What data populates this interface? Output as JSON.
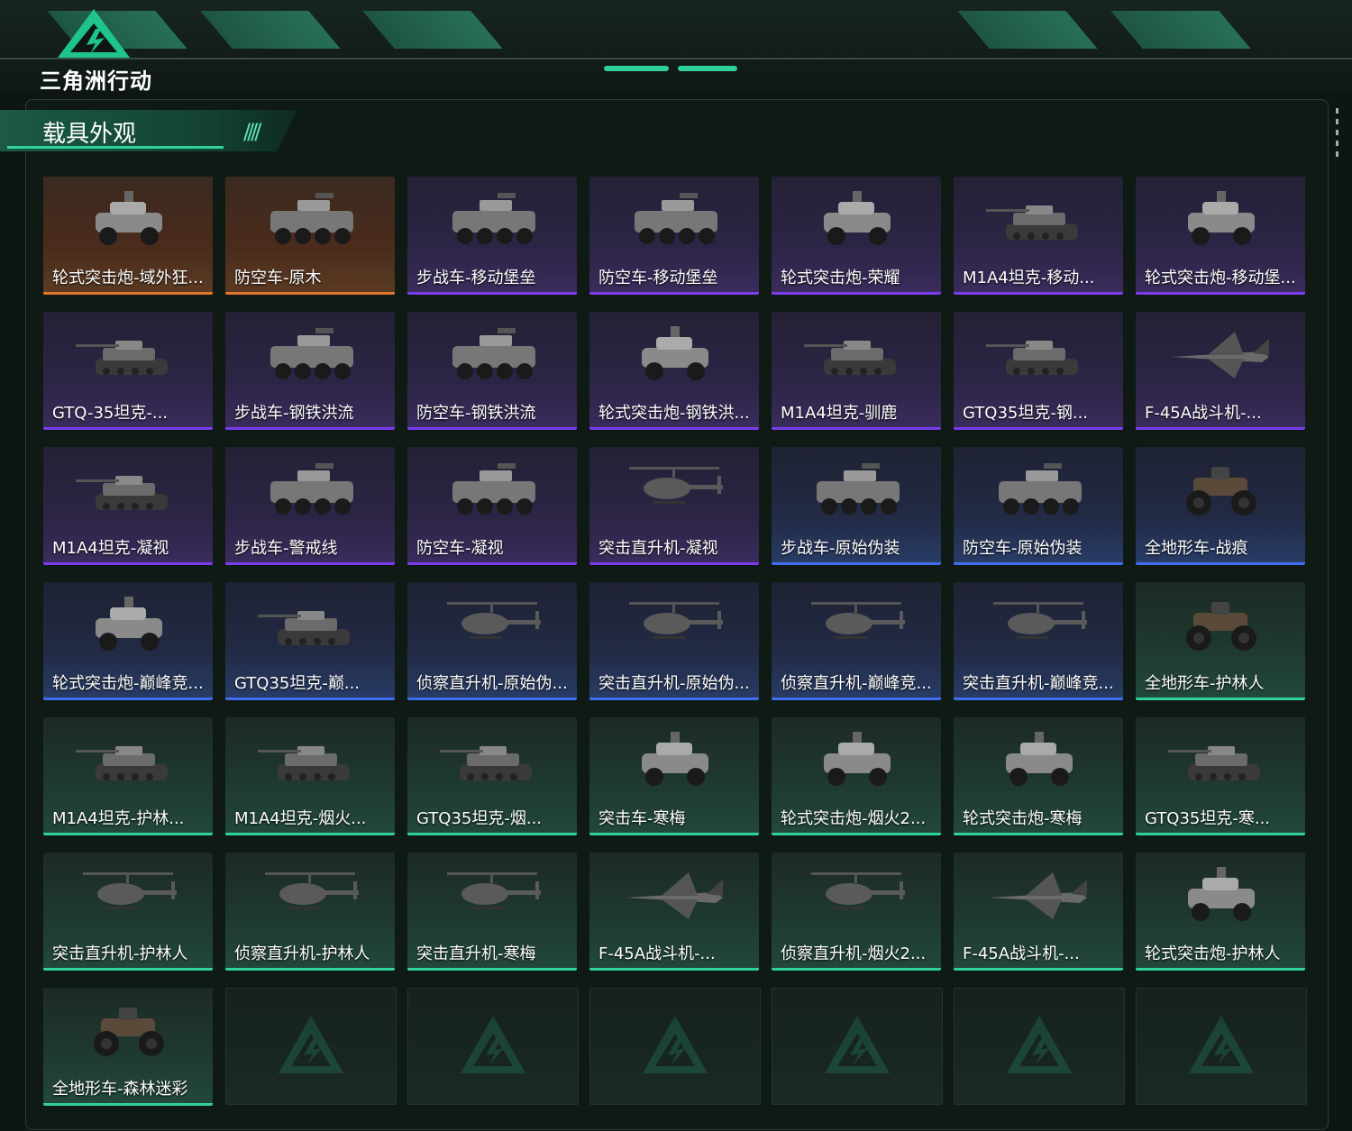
{
  "game": {
    "title": "三角洲行动"
  },
  "section": {
    "title": "载具外观"
  },
  "colors": {
    "orange": "#e0762c",
    "purple": "#7a3df0",
    "blue": "#3f6ef0",
    "green": "#2ed19a"
  },
  "items": [
    {
      "label": "轮式突击炮-域外狂...",
      "rarity": "orange",
      "kind": "apc"
    },
    {
      "label": "防空车-原木",
      "rarity": "orange",
      "kind": "ifv"
    },
    {
      "label": "步战车-移动堡垒",
      "rarity": "purple",
      "kind": "ifv"
    },
    {
      "label": "防空车-移动堡垒",
      "rarity": "purple",
      "kind": "ifv"
    },
    {
      "label": "轮式突击炮-荣耀",
      "rarity": "purple",
      "kind": "apc"
    },
    {
      "label": "M1A4坦克-移动...",
      "rarity": "purple",
      "kind": "tank"
    },
    {
      "label": "轮式突击炮-移动堡...",
      "rarity": "purple",
      "kind": "apc"
    },
    {
      "label": "GTQ-35坦克-...",
      "rarity": "purple",
      "kind": "tank"
    },
    {
      "label": "步战车-钢铁洪流",
      "rarity": "purple",
      "kind": "ifv"
    },
    {
      "label": "防空车-钢铁洪流",
      "rarity": "purple",
      "kind": "ifv"
    },
    {
      "label": "轮式突击炮-钢铁洪...",
      "rarity": "purple",
      "kind": "apc"
    },
    {
      "label": "M1A4坦克-驯鹿",
      "rarity": "purple",
      "kind": "tank"
    },
    {
      "label": "GTQ35坦克-钢...",
      "rarity": "purple",
      "kind": "tank"
    },
    {
      "label": "F-45A战斗机-...",
      "rarity": "purple",
      "kind": "jet"
    },
    {
      "label": "M1A4坦克-凝视",
      "rarity": "purple",
      "kind": "tank"
    },
    {
      "label": "步战车-警戒线",
      "rarity": "purple",
      "kind": "ifv"
    },
    {
      "label": "防空车-凝视",
      "rarity": "purple",
      "kind": "ifv"
    },
    {
      "label": "突击直升机-凝视",
      "rarity": "purple",
      "kind": "heli"
    },
    {
      "label": "步战车-原始伪装",
      "rarity": "blue",
      "kind": "ifv"
    },
    {
      "label": "防空车-原始伪装",
      "rarity": "blue",
      "kind": "ifv"
    },
    {
      "label": "全地形车-战痕",
      "rarity": "blue",
      "kind": "atv"
    },
    {
      "label": "轮式突击炮-巅峰竞...",
      "rarity": "blue",
      "kind": "apc"
    },
    {
      "label": "GTQ35坦克-巅...",
      "rarity": "blue",
      "kind": "tank"
    },
    {
      "label": "侦察直升机-原始伪...",
      "rarity": "blue",
      "kind": "heli"
    },
    {
      "label": "突击直升机-原始伪...",
      "rarity": "blue",
      "kind": "heli"
    },
    {
      "label": "侦察直升机-巅峰竞...",
      "rarity": "blue",
      "kind": "heli"
    },
    {
      "label": "突击直升机-巅峰竞...",
      "rarity": "blue",
      "kind": "heli"
    },
    {
      "label": "全地形车-护林人",
      "rarity": "green",
      "kind": "atv"
    },
    {
      "label": "M1A4坦克-护林...",
      "rarity": "green",
      "kind": "tank"
    },
    {
      "label": "M1A4坦克-烟火...",
      "rarity": "green",
      "kind": "tank"
    },
    {
      "label": "GTQ35坦克-烟...",
      "rarity": "green",
      "kind": "tank"
    },
    {
      "label": "突击车-寒梅",
      "rarity": "green",
      "kind": "apc"
    },
    {
      "label": "轮式突击炮-烟火2...",
      "rarity": "green",
      "kind": "apc"
    },
    {
      "label": "轮式突击炮-寒梅",
      "rarity": "green",
      "kind": "apc"
    },
    {
      "label": "GTQ35坦克-寒...",
      "rarity": "green",
      "kind": "tank"
    },
    {
      "label": "突击直升机-护林人",
      "rarity": "green",
      "kind": "heli"
    },
    {
      "label": "侦察直升机-护林人",
      "rarity": "green",
      "kind": "heli"
    },
    {
      "label": "突击直升机-寒梅",
      "rarity": "green",
      "kind": "heli"
    },
    {
      "label": "F-45A战斗机-...",
      "rarity": "green",
      "kind": "jet"
    },
    {
      "label": "侦察直升机-烟火2...",
      "rarity": "green",
      "kind": "heli"
    },
    {
      "label": "F-45A战斗机-...",
      "rarity": "green",
      "kind": "jet"
    },
    {
      "label": "轮式突击炮-护林人",
      "rarity": "green",
      "kind": "apc"
    },
    {
      "label": "全地形车-森林迷彩",
      "rarity": "green",
      "kind": "atv"
    }
  ],
  "empty_slots": 6
}
